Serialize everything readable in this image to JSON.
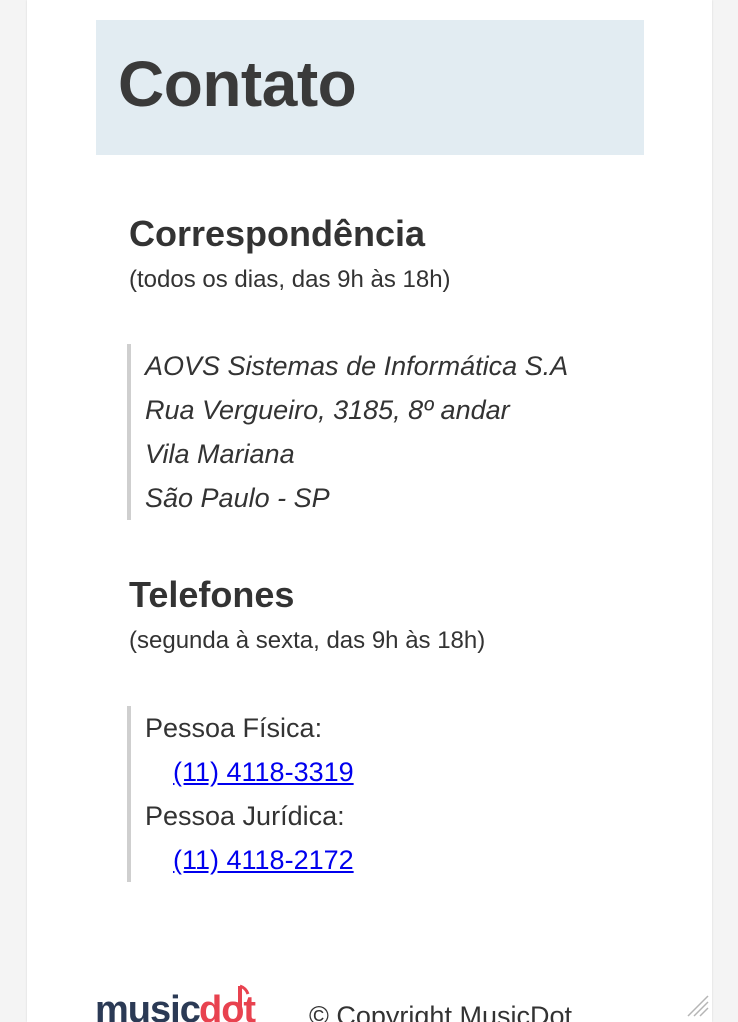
{
  "page": {
    "title": "Contato"
  },
  "correspondencia": {
    "heading": "Correspondência",
    "hours": "(todos os dias, das 9h às 18h)",
    "address_lines": [
      "AOVS Sistemas de Informática S.A",
      "Rua Vergueiro, 3185, 8º andar",
      "Vila Mariana",
      "São Paulo - SP"
    ]
  },
  "telefones": {
    "heading": "Telefones",
    "hours": "(segunda à sexta, das 9h às 18h)",
    "items": [
      {
        "label": "Pessoa Física:",
        "number": "(11) 4118-3319"
      },
      {
        "label": "Pessoa Jurídica:",
        "number": "(11) 4118-2172"
      }
    ]
  },
  "footer": {
    "logo_text": "musicdot",
    "logo_icon": "music-note-icon",
    "copyright": "© Copyright MusicDot"
  },
  "colors": {
    "banner_bg": "#e2ecf2",
    "link": "#0000ee",
    "logo_dark": "#2b3a55",
    "logo_accent": "#e8424f",
    "quote_border": "#cfcfcf"
  }
}
